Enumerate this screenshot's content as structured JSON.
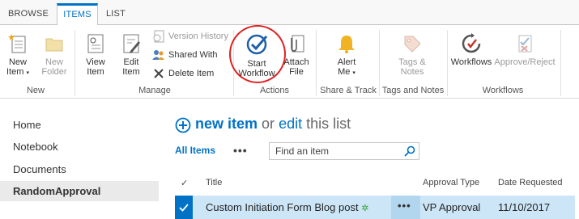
{
  "tabs": [
    {
      "label": "BROWSE"
    },
    {
      "label": "ITEMS"
    },
    {
      "label": "LIST"
    }
  ],
  "ribbon": {
    "new_group": {
      "label": "New",
      "new_item": "New Item",
      "new_folder": "New Folder"
    },
    "manage_group": {
      "label": "Manage",
      "view_item": "View Item",
      "edit_item": "Edit Item",
      "version_history": "Version History",
      "shared_with": "Shared With",
      "delete_item": "Delete Item"
    },
    "actions_group": {
      "label": "Actions",
      "start_workflow": "Start Workflow",
      "attach_file": "Attach File"
    },
    "share_group": {
      "label": "Share & Track",
      "alert_me": "Alert Me"
    },
    "tags_group": {
      "label": "Tags and Notes",
      "tags_notes": "Tags & Notes"
    },
    "workflows_group": {
      "label": "Workflows",
      "workflows": "Workflows",
      "approve_reject": "Approve/Reject"
    }
  },
  "nav": {
    "items": [
      {
        "label": "Home"
      },
      {
        "label": "Notebook"
      },
      {
        "label": "Documents"
      },
      {
        "label": "RandomApproval"
      }
    ]
  },
  "main": {
    "new_item": "new item",
    "or": "or",
    "edit": "edit",
    "this_list": "this list",
    "view_name": "All Items",
    "ellipsis": "•••",
    "search_placeholder": "Find an item",
    "columns": {
      "check": "✓",
      "title": "Title",
      "approval_type": "Approval Type",
      "date_requested": "Date Requested"
    },
    "rows": [
      {
        "title": "Custom Initiation Form Blog post",
        "new_marker": "✲",
        "approval_type": "VP Approval",
        "date_requested": "11/10/2017"
      }
    ]
  },
  "colors": {
    "accent": "#0072c6",
    "selection": "#cde6f7",
    "highlight_circle": "#dd2222"
  }
}
